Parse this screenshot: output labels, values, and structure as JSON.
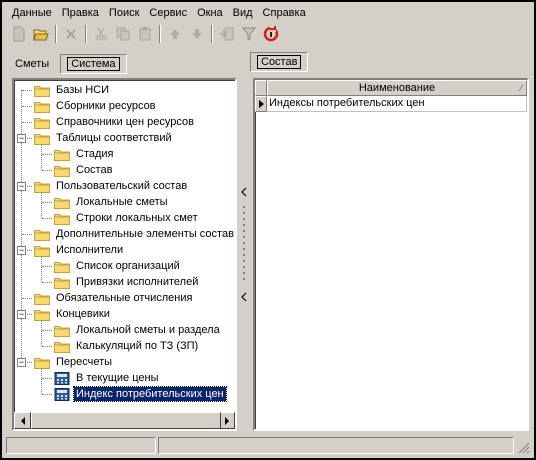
{
  "menu": [
    "Данные",
    "Правка",
    "Поиск",
    "Сервис",
    "Окна",
    "Вид",
    "Справка"
  ],
  "toolbar": {
    "icons": [
      "new-icon",
      "open-icon",
      "delete-icon",
      "cut-icon",
      "copy-icon",
      "paste-icon",
      "arrow-up-icon",
      "arrow-down-icon",
      "import-icon",
      "filter-icon",
      "refresh-icon"
    ]
  },
  "left_tabs": [
    {
      "label": "Сметы",
      "active": false
    },
    {
      "label": "Система",
      "active": true
    }
  ],
  "right_tabs": [
    {
      "label": "Состав",
      "active": true
    }
  ],
  "tree": [
    {
      "label": "Базы НСИ",
      "level": 0,
      "expander": "",
      "selected": false
    },
    {
      "label": "Сборники ресурсов",
      "level": 0,
      "expander": "",
      "selected": false
    },
    {
      "label": "Справочники цен ресурсов",
      "level": 0,
      "expander": "",
      "selected": false
    },
    {
      "label": "Таблицы соответствий",
      "level": 0,
      "expander": "−",
      "selected": false
    },
    {
      "label": "Стадия",
      "level": 1,
      "expander": "",
      "selected": false
    },
    {
      "label": "Состав",
      "level": 1,
      "expander": "",
      "selected": false
    },
    {
      "label": "Пользовательский состав",
      "level": 0,
      "expander": "−",
      "selected": false
    },
    {
      "label": "Локальные сметы",
      "level": 1,
      "expander": "",
      "selected": false
    },
    {
      "label": "Строки локальных смет",
      "level": 1,
      "expander": "",
      "selected": false
    },
    {
      "label": "Дополнительные элементы состав",
      "level": 0,
      "expander": "",
      "selected": false
    },
    {
      "label": "Исполнители",
      "level": 0,
      "expander": "−",
      "selected": false
    },
    {
      "label": "Список организаций",
      "level": 1,
      "expander": "",
      "selected": false
    },
    {
      "label": "Привязки исполнителей",
      "level": 1,
      "expander": "",
      "selected": false
    },
    {
      "label": "Обязательные отчисления",
      "level": 0,
      "expander": "",
      "selected": false
    },
    {
      "label": "Концевики",
      "level": 0,
      "expander": "−",
      "selected": false
    },
    {
      "label": "Локальной сметы и раздела",
      "level": 1,
      "expander": "",
      "selected": false
    },
    {
      "label": "Калькуляций по ТЗ (ЗП)",
      "level": 1,
      "expander": "",
      "selected": false
    },
    {
      "label": "Пересчеты",
      "level": 0,
      "expander": "−",
      "selected": false
    },
    {
      "label": "В текущие цены",
      "level": 1,
      "expander": "",
      "selected": false,
      "icon": "calc"
    },
    {
      "label": "Индекс потребительских цен",
      "level": 1,
      "expander": "",
      "selected": true,
      "icon": "calc"
    }
  ],
  "grid": {
    "column": "Наименование",
    "rows": [
      "Индексы потребительских цен"
    ]
  },
  "colors": {
    "selection": "#0a246a",
    "folder": "#f8d775",
    "folder_dark": "#c9a33a"
  }
}
